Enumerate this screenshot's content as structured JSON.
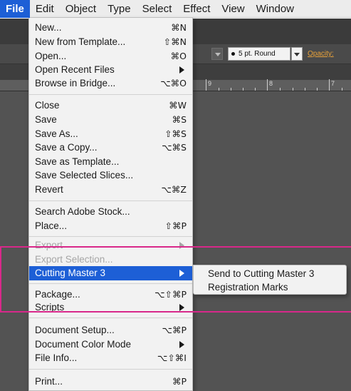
{
  "menubar": {
    "items": [
      "File",
      "Edit",
      "Object",
      "Type",
      "Select",
      "Effect",
      "View",
      "Window"
    ],
    "active_index": 0
  },
  "controlbar": {
    "stroke_profile": "5 pt. Round",
    "opacity_label": "Opacity:"
  },
  "ruler": {
    "numbers": [
      "9",
      "8",
      "7"
    ]
  },
  "file_menu": {
    "items": [
      {
        "label": "New...",
        "shortcut": "⌘N"
      },
      {
        "label": "New from Template...",
        "shortcut": "⇧⌘N"
      },
      {
        "label": "Open...",
        "shortcut": "⌘O"
      },
      {
        "label": "Open Recent Files",
        "shortcut": ""
      },
      {
        "label": "Browse in Bridge...",
        "shortcut": "⌥⌘O"
      },
      {
        "label": "Close",
        "shortcut": "⌘W"
      },
      {
        "label": "Save",
        "shortcut": "⌘S"
      },
      {
        "label": "Save As...",
        "shortcut": "⇧⌘S"
      },
      {
        "label": "Save a Copy...",
        "shortcut": "⌥⌘S"
      },
      {
        "label": "Save as Template...",
        "shortcut": ""
      },
      {
        "label": "Save Selected Slices...",
        "shortcut": ""
      },
      {
        "label": "Revert",
        "shortcut": "⌥⌘Z"
      },
      {
        "label": "Search Adobe Stock...",
        "shortcut": ""
      },
      {
        "label": "Place...",
        "shortcut": "⇧⌘P"
      },
      {
        "label": "Export",
        "shortcut": ""
      },
      {
        "label": "Export Selection...",
        "shortcut": ""
      },
      {
        "label": "Cutting Master 3",
        "shortcut": ""
      },
      {
        "label": "Package...",
        "shortcut": "⌥⇧⌘P"
      },
      {
        "label": "Scripts",
        "shortcut": ""
      },
      {
        "label": "Document Setup...",
        "shortcut": "⌥⌘P"
      },
      {
        "label": "Document Color Mode",
        "shortcut": ""
      },
      {
        "label": "File Info...",
        "shortcut": "⌥⇧⌘I"
      },
      {
        "label": "Print...",
        "shortcut": "⌘P"
      }
    ]
  },
  "submenu": {
    "items": [
      "Send to Cutting Master 3",
      "Registration Marks"
    ]
  },
  "colors": {
    "highlight": "#1d5fd6",
    "annotation": "#d8288a",
    "app_background": "#535353"
  }
}
